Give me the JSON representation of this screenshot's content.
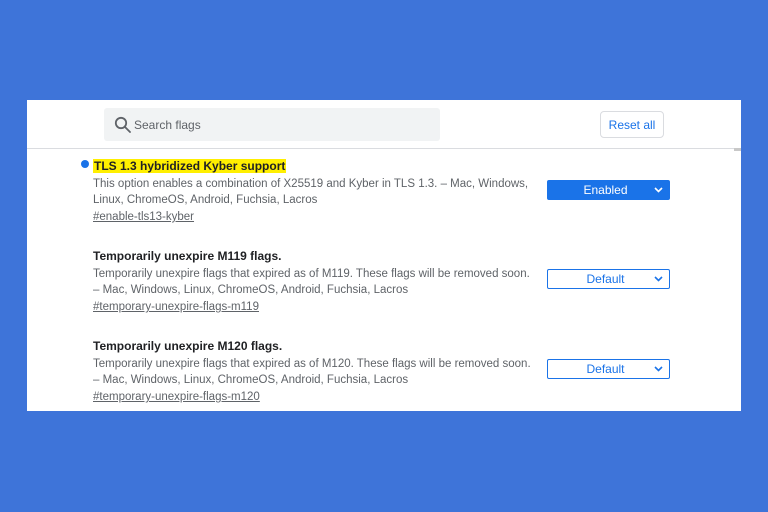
{
  "header": {
    "search": {
      "placeholder": "Search flags",
      "value": ""
    },
    "reset_label": "Reset all"
  },
  "flags": [
    {
      "title": "TLS 1.3 hybridized Kyber support",
      "description": "This option enables a combination of X25519 and Kyber in TLS 1.3. – Mac, Windows, Linux, ChromeOS, Android, Fuchsia, Lacros",
      "link": "#enable-tls13-kyber",
      "state": "Enabled",
      "modified": true
    },
    {
      "title": "Temporarily unexpire M119 flags.",
      "description": "Temporarily unexpire flags that expired as of M119. These flags will be removed soon. – Mac, Windows, Linux, ChromeOS, Android, Fuchsia, Lacros",
      "link": "#temporary-unexpire-flags-m119",
      "state": "Default",
      "modified": false
    },
    {
      "title": "Temporarily unexpire M120 flags.",
      "description": "Temporarily unexpire flags that expired as of M120. These flags will be removed soon. – Mac, Windows, Linux, ChromeOS, Android, Fuchsia, Lacros",
      "link": "#temporary-unexpire-flags-m120",
      "state": "Default",
      "modified": false
    }
  ],
  "colors": {
    "background": "#3e74d9",
    "accent": "#1a73e8",
    "highlight": "#ffef00"
  },
  "icons": [
    "search-icon",
    "chevron-down-icon",
    "modified-dot"
  ]
}
